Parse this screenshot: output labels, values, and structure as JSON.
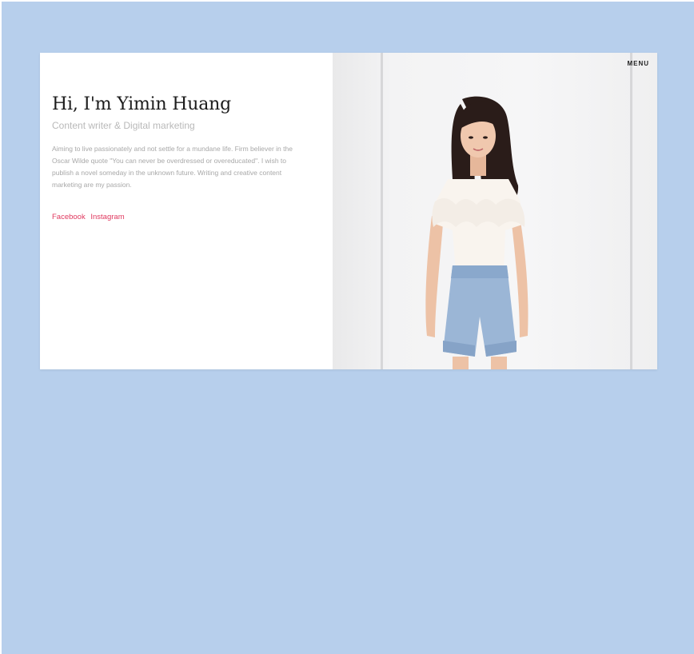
{
  "hero": {
    "title": "Hi, I'm Yimin Huang",
    "subtitle": "Content writer & Digital marketing",
    "bio": "Aiming to live passionately and not settle for a mundane life. Firm believer in the Oscar Wilde quote \"You can never be overdressed or overeducated\". I wish to publish a novel someday in the unknown future. Writing and creative content marketing are my passion."
  },
  "social": {
    "facebook": "Facebook",
    "instagram": "Instagram"
  },
  "nav": {
    "menu_label": "MENU"
  },
  "colors": {
    "background": "#b7cfec",
    "link": "#e0395f",
    "title": "#1c1c1c",
    "subtitle": "#b9b9b9"
  }
}
